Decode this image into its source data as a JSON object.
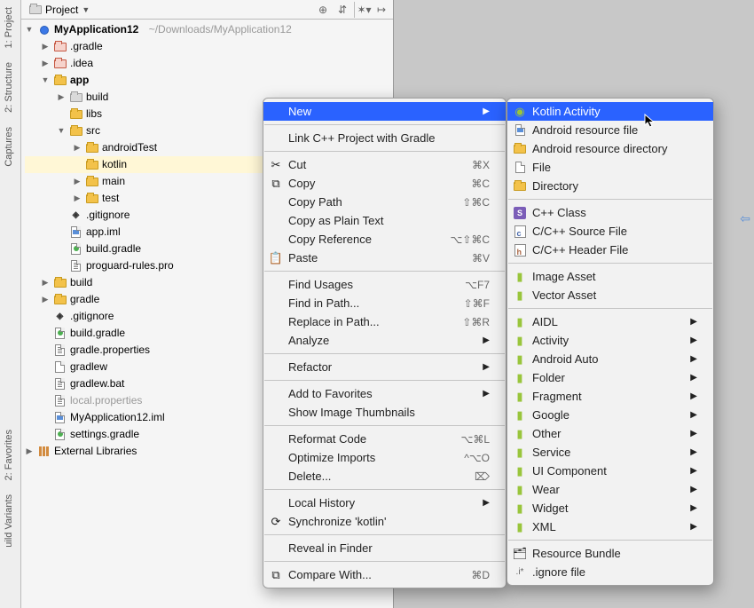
{
  "rail": {
    "project": "1: Project",
    "structure": "2: Structure",
    "captures": "Captures",
    "favorites": "2: Favorites",
    "build_variants": "uild Variants"
  },
  "panel": {
    "title": "Project"
  },
  "tree": {
    "root_name": "MyApplication12",
    "root_path": "~/Downloads/MyApplication12",
    "gradle_dir": ".gradle",
    "idea_dir": ".idea",
    "app": "app",
    "build": "build",
    "libs": "libs",
    "src": "src",
    "androidTest": "androidTest",
    "kotlin": "kotlin",
    "main": "main",
    "test": "test",
    "gitignore": ".gitignore",
    "app_iml": "app.iml",
    "build_gradle": "build.gradle",
    "proguard": "proguard-rules.pro",
    "build2": "build",
    "gradle2": "gradle",
    "gitignore2": ".gitignore",
    "build_gradle2": "build.gradle",
    "gradle_props": "gradle.properties",
    "gradlew": "gradlew",
    "gradlew_bat": "gradlew.bat",
    "local_props": "local.properties",
    "app_iml2": "MyApplication12.iml",
    "settings_gradle": "settings.gradle",
    "external_libs": "External Libraries"
  },
  "ctx": {
    "new": "New",
    "link_cpp": "Link C++ Project with Gradle",
    "cut": "Cut",
    "cut_sc": "⌘X",
    "copy": "Copy",
    "copy_sc": "⌘C",
    "copy_path": "Copy Path",
    "copy_path_sc": "⇧⌘C",
    "copy_plain": "Copy as Plain Text",
    "copy_ref": "Copy Reference",
    "copy_ref_sc": "⌥⇧⌘C",
    "paste": "Paste",
    "paste_sc": "⌘V",
    "find_usages": "Find Usages",
    "find_usages_sc": "⌥F7",
    "find_in_path": "Find in Path...",
    "find_in_path_sc": "⇧⌘F",
    "replace_in_path": "Replace in Path...",
    "replace_in_path_sc": "⇧⌘R",
    "analyze": "Analyze",
    "refactor": "Refactor",
    "add_fav": "Add to Favorites",
    "show_thumbs": "Show Image Thumbnails",
    "reformat": "Reformat Code",
    "reformat_sc": "⌥⌘L",
    "optimize": "Optimize Imports",
    "optimize_sc": "^⌥O",
    "delete": "Delete...",
    "delete_sc": "⌦",
    "local_history": "Local History",
    "synchronize": "Synchronize 'kotlin'",
    "reveal": "Reveal in Finder",
    "compare": "Compare With...",
    "compare_sc": "⌘D"
  },
  "sub": {
    "kotlin_activity": "Kotlin Activity",
    "android_res_file": "Android resource file",
    "android_res_dir": "Android resource directory",
    "file": "File",
    "directory": "Directory",
    "cpp_class": "C++ Class",
    "cpp_source": "C/C++ Source File",
    "cpp_header": "C/C++ Header File",
    "image_asset": "Image Asset",
    "vector_asset": "Vector Asset",
    "aidl": "AIDL",
    "activity": "Activity",
    "android_auto": "Android Auto",
    "folder": "Folder",
    "fragment": "Fragment",
    "google": "Google",
    "other": "Other",
    "service": "Service",
    "ui_component": "UI Component",
    "wear": "Wear",
    "widget": "Widget",
    "xml": "XML",
    "resource_bundle": "Resource Bundle",
    "ignore_file": ".ignore file"
  }
}
